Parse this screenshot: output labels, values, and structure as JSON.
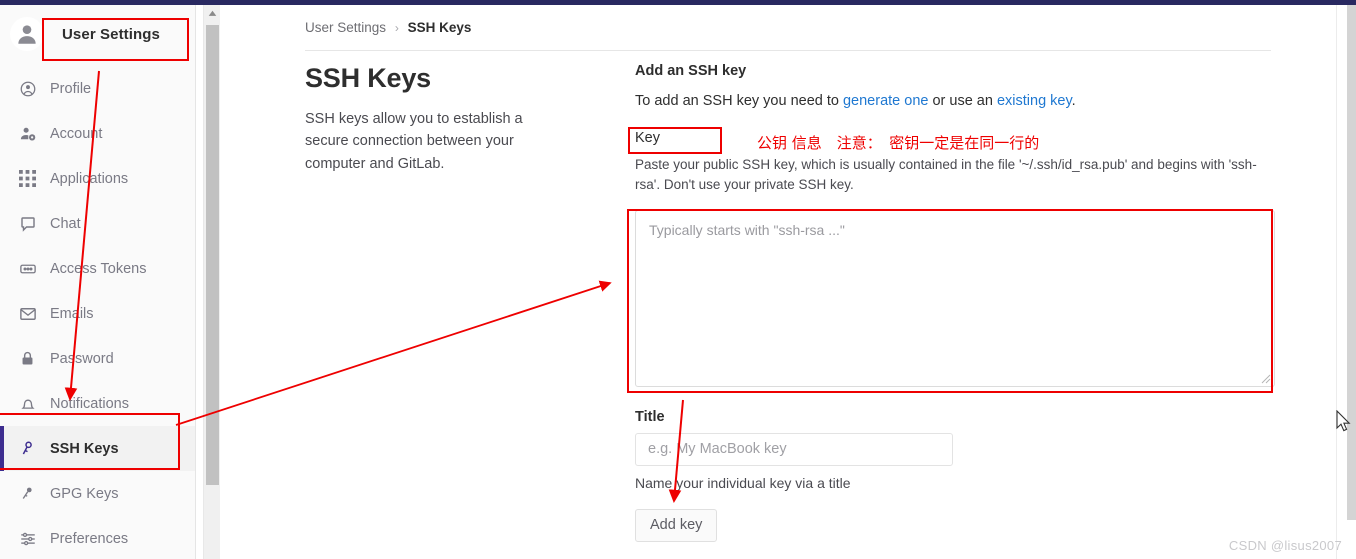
{
  "window": {
    "topbar_color": "#292961"
  },
  "sidebar": {
    "title": "User Settings",
    "avatar_icon": "user-avatar-icon",
    "items": [
      {
        "label": "Profile",
        "icon": "profile-circle-icon",
        "active": false
      },
      {
        "label": "Account",
        "icon": "account-gear-icon",
        "active": false
      },
      {
        "label": "Applications",
        "icon": "grid-apps-icon",
        "active": false
      },
      {
        "label": "Chat",
        "icon": "chat-bubble-icon",
        "active": false
      },
      {
        "label": "Access Tokens",
        "icon": "token-card-icon",
        "active": false
      },
      {
        "label": "Emails",
        "icon": "envelope-icon",
        "active": false
      },
      {
        "label": "Password",
        "icon": "lock-icon",
        "active": false
      },
      {
        "label": "Notifications",
        "icon": "bell-icon",
        "active": false
      },
      {
        "label": "SSH Keys",
        "icon": "key-icon",
        "active": true
      },
      {
        "label": "GPG Keys",
        "icon": "key-outline-icon",
        "active": false
      },
      {
        "label": "Preferences",
        "icon": "sliders-icon",
        "active": false
      }
    ],
    "active_accent": "#3d2d8f",
    "scrollbar": {
      "up_arrow_icon": "scroll-up-arrow-icon"
    }
  },
  "breadcrumb": {
    "parent": "User Settings",
    "separator": "›",
    "current": "SSH Keys"
  },
  "page": {
    "title": "SSH Keys",
    "description": "SSH keys allow you to establish a secure connection between your computer and GitLab."
  },
  "form": {
    "section_title": "Add an SSH key",
    "intro_before": "To add an SSH key you need to ",
    "link_generate": "generate one",
    "intro_middle": " or use an ",
    "link_existing": "existing key",
    "intro_after": ".",
    "key_label": "Key",
    "key_help": "Paste your public SSH key, which is usually contained in the file '~/.ssh/id_rsa.pub' and begins with 'ssh-rsa'. Don't use your private SSH key.",
    "key_placeholder": "Typically starts with \"ssh-rsa ...\"",
    "key_value": "",
    "title_label": "Title",
    "title_placeholder": "e.g. My MacBook key",
    "title_value": "",
    "title_help": "Name your individual key via a title",
    "submit_label": "Add key"
  },
  "annotations": {
    "color": "#ee0000",
    "chinese_note": "公钥 信息　注意：　密钥一定是在同一行的",
    "boxes": [
      {
        "name": "user-settings-highlight"
      },
      {
        "name": "ssh-keys-nav-highlight"
      },
      {
        "name": "key-label-highlight"
      },
      {
        "name": "key-textarea-highlight"
      }
    ]
  },
  "watermark": "CSDN @lisus2007"
}
